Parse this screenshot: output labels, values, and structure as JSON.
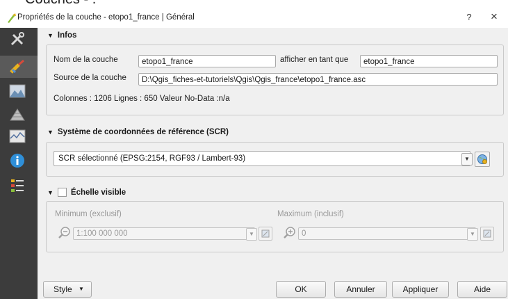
{
  "cut_top_text": "Couches - .",
  "window": {
    "title": "Propriétés de la couche - etopo1_france | Général",
    "help": "?",
    "close": "×"
  },
  "sidebar": {
    "items": [
      {
        "icon": "general-tools-icon"
      },
      {
        "icon": "style-brush-icon"
      },
      {
        "icon": "transparency-icon"
      },
      {
        "icon": "pyramids-icon"
      },
      {
        "icon": "histogram-icon"
      },
      {
        "icon": "metadata-info-icon"
      },
      {
        "icon": "legend-icon"
      }
    ]
  },
  "infos": {
    "header": "Infos",
    "layer_name_label": "Nom de la couche",
    "layer_name_value": "etopo1_france",
    "display_as_label": "afficher en tant que",
    "display_as_value": "etopo1_france",
    "source_label": "Source de la couche",
    "source_value": "D:\\Qgis_fiches-et-tutoriels\\Qgis\\Qgis_france\\etopo1_france.asc",
    "stats": "Colonnes : 1206  Lignes : 650  Valeur No-Data :n/a"
  },
  "crs": {
    "header": "Système de coordonnées de référence (SCR)",
    "selected": "SCR sélectionné (EPSG:2154, RGF93 / Lambert-93)"
  },
  "scale": {
    "header": "Échelle visible",
    "checked": false,
    "min_label": "Minimum (exclusif)",
    "min_value": "1:100 000 000",
    "max_label": "Maximum (inclusif)",
    "max_value": "0"
  },
  "buttons": {
    "style": "Style",
    "ok": "OK",
    "cancel": "Annuler",
    "apply": "Appliquer",
    "help": "Aide"
  }
}
